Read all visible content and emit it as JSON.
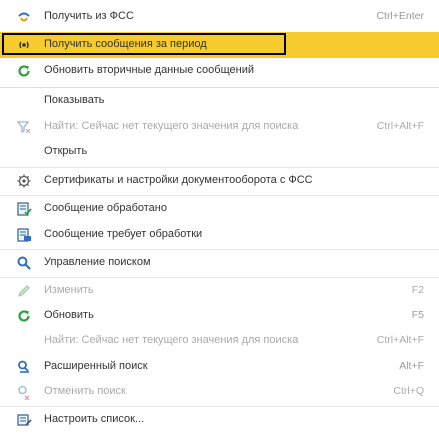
{
  "menu": {
    "items": [
      {
        "label": "Получить из ФСС",
        "shortcut": "Ctrl+Enter",
        "icon": "fss-receive-icon"
      },
      {
        "label": "Получить сообщения за период",
        "shortcut": "",
        "icon": "signal-broadcast-icon"
      },
      {
        "label": "Обновить вторичные данные сообщений",
        "shortcut": "",
        "icon": "refresh-icon"
      },
      {
        "label": "Показывать",
        "shortcut": ""
      },
      {
        "label": "Найти: Сейчас нет текущего значения для поиска",
        "shortcut": "Ctrl+Alt+F",
        "icon": "filter-icon"
      },
      {
        "label": "Открыть",
        "shortcut": ""
      },
      {
        "label": "Сертификаты и настройки документооборота с ФСС",
        "shortcut": "",
        "icon": "gear-icon"
      },
      {
        "label": "Сообщение обработано",
        "shortcut": "",
        "icon": "document-processed-icon"
      },
      {
        "label": "Сообщение требует обработки",
        "shortcut": "",
        "icon": "document-pending-icon"
      },
      {
        "label": "Управление поиском",
        "shortcut": "",
        "icon": "search-icon"
      },
      {
        "label": "Изменить",
        "shortcut": "F2",
        "icon": "pencil-icon"
      },
      {
        "label": "Обновить",
        "shortcut": "F5",
        "icon": "refresh-icon"
      },
      {
        "label": "Найти: Сейчас нет текущего значения для поиска",
        "shortcut": "Ctrl+Alt+F"
      },
      {
        "label": "Расширенный поиск",
        "shortcut": "Alt+F",
        "icon": "advanced-search-icon"
      },
      {
        "label": "Отменить поиск",
        "shortcut": "Ctrl+Q",
        "icon": "cancel-search-icon"
      },
      {
        "label": "Настроить список...",
        "shortcut": "",
        "icon": "list-settings-icon"
      }
    ]
  },
  "colors": {
    "highlight": "#f6cb2e",
    "green_icon": "#2e9f3a",
    "blue_icon": "#2f6fbf",
    "disabled_text": "#aaaaaa"
  }
}
